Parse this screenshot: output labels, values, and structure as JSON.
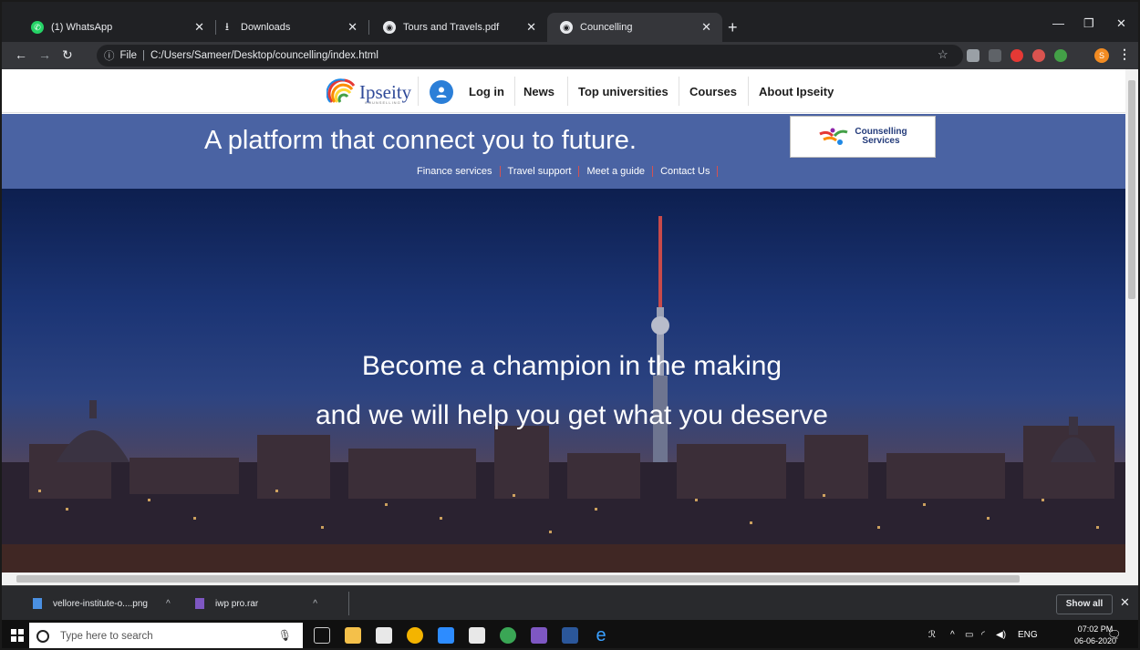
{
  "browser": {
    "tabs": [
      {
        "label": "(1) WhatsApp",
        "icon": "whatsapp-icon",
        "active": false
      },
      {
        "label": "Downloads",
        "icon": "download-icon",
        "active": false
      },
      {
        "label": "Tours and Travels.pdf",
        "icon": "globe-icon",
        "active": false
      },
      {
        "label": "Councelling",
        "icon": "globe-icon",
        "active": true
      }
    ],
    "address": {
      "scheme_label": "File",
      "url": "C:/Users/Sameer/Desktop/councelling/index.html"
    },
    "profile_initial": "S"
  },
  "site": {
    "logo_text": "Ipseity",
    "logo_sub": "COUNSELLING",
    "nav": {
      "login": "Log in",
      "news": "News",
      "top_universities": "Top universities",
      "courses": "Courses",
      "about": "About Ipseity"
    },
    "tagline": "A platform that connect you to future.",
    "subnav": [
      "Finance services",
      "Travel support",
      "Meet a guide",
      "Contact Us"
    ],
    "counselling_logo": {
      "line1": "Counselling",
      "line2": "Services"
    },
    "hero": {
      "line1": "Become a champion in the making",
      "line2": "and we will help you get what you deserve"
    }
  },
  "downloads": {
    "items": [
      {
        "name": "vellore-institute-o....png",
        "icon": "image-file-icon"
      },
      {
        "name": "iwp pro.rar",
        "icon": "rar-archive-icon"
      }
    ],
    "show_all": "Show all"
  },
  "taskbar": {
    "search_placeholder": "Type here to search",
    "language": "ENG",
    "time": "07:02 PM",
    "date": "06-06-2020"
  },
  "colors": {
    "chrome_dark": "#202124",
    "band_blue": "#4a63a3",
    "login_blue": "#2b7fd8",
    "logo_blue": "#2f4a99"
  }
}
